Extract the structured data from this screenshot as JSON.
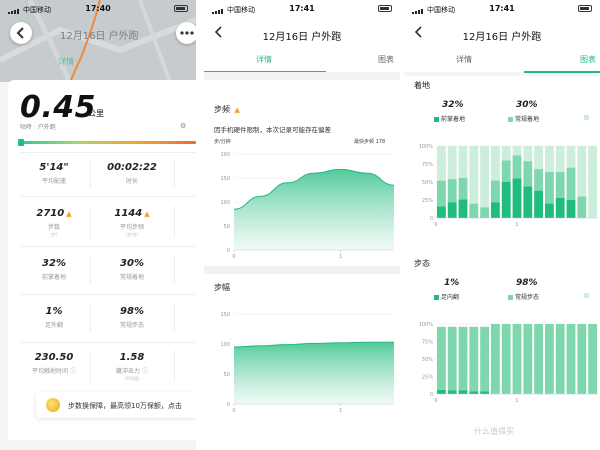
{
  "status": {
    "carrier": "中国移动"
  },
  "panel1": {
    "time": "17:40",
    "title": "12月16日 户外跑",
    "tab_detail": "详情",
    "distance": "0.45",
    "distance_unit": "公里",
    "crumb": "咕咚 · 户外跑",
    "stats": [
      {
        "value": "5'14\"",
        "label": "平均配速",
        "sub": ""
      },
      {
        "value": "00:02:22",
        "label": "时长",
        "sub": ""
      },
      {
        "value": "2710",
        "label": "步数",
        "sub": "(步)",
        "warn": true
      },
      {
        "value": "1144",
        "label": "平均步频",
        "sub": "(步/分)",
        "warn": true
      },
      {
        "value": "32%",
        "label": "前掌着地",
        "sub": ""
      },
      {
        "value": "30%",
        "label": "常规着地",
        "sub": ""
      },
      {
        "value": "1%",
        "label": "足外翻",
        "sub": ""
      },
      {
        "value": "98%",
        "label": "常规步态",
        "sub": ""
      },
      {
        "value": "230.50",
        "label": "平均触地时间",
        "sub": "",
        "info": true
      },
      {
        "value": "1.58",
        "label": "罐冲击力",
        "sub": "(不同值)",
        "info": true
      }
    ],
    "promo": "步数换保障，最高领10万保额，点击"
  },
  "panel2": {
    "time": "17:41",
    "title": "12月16日 户外跑",
    "tab_detail": "详情",
    "tab_chart": "图表",
    "cadence": {
      "title": "步频",
      "note": "因手机硬件限制，本次记录可能存在偏差",
      "unit": "步/分钟",
      "max_label": "最快步频 178",
      "yticks": [
        "200",
        "150",
        "100",
        "50",
        "0"
      ],
      "xticks": [
        "0",
        "1"
      ]
    },
    "stride": {
      "title": "步幅",
      "yticks": [
        "150",
        "100",
        "50",
        "0"
      ],
      "xticks": [
        "0",
        "1"
      ]
    }
  },
  "panel3": {
    "time": "17:41",
    "title": "12月16日 户外跑",
    "tab_detail": "详情",
    "tab_chart": "图表",
    "landing": {
      "title": "着地",
      "pct1": "32%",
      "pct2": "30%",
      "legend1": "前掌着地",
      "legend2": "常规着地",
      "yticks": [
        "100%",
        "75%",
        "50%",
        "25%",
        "0"
      ],
      "xticks": [
        "0",
        "1"
      ]
    },
    "gait": {
      "title": "步态",
      "pct1": "1%",
      "pct2": "98%",
      "legend1": "足内翻",
      "legend2": "常规步态",
      "yticks": [
        "100%",
        "75%",
        "50%",
        "25%",
        "0"
      ],
      "xticks": [
        "0",
        "1"
      ]
    },
    "watermark": "什么值得买"
  },
  "chart_data": [
    {
      "type": "area",
      "title": "步频",
      "x": [
        0,
        0.25,
        0.5,
        0.75,
        1,
        1.25,
        1.5
      ],
      "values": [
        85,
        112,
        140,
        160,
        168,
        160,
        135
      ],
      "ylim": [
        0,
        200
      ]
    },
    {
      "type": "area",
      "title": "步幅",
      "x": [
        0,
        0.25,
        0.5,
        0.75,
        1,
        1.25,
        1.5
      ],
      "values": [
        95,
        97,
        99,
        101,
        102,
        103,
        103
      ],
      "ylim": [
        0,
        150
      ]
    },
    {
      "type": "bar",
      "title": "着地",
      "categories": [
        "1",
        "2",
        "3",
        "4",
        "5",
        "6",
        "7",
        "8",
        "9",
        "10",
        "11",
        "12",
        "13",
        "14",
        "15"
      ],
      "series": [
        {
          "name": "前掌着地",
          "values": [
            16,
            22,
            26,
            0,
            0,
            22,
            50,
            55,
            44,
            38,
            20,
            28,
            25,
            0,
            0
          ]
        },
        {
          "name": "常规着地",
          "values": [
            36,
            32,
            30,
            20,
            15,
            30,
            30,
            32,
            35,
            30,
            44,
            36,
            45,
            30,
            0
          ]
        },
        {
          "name": "",
          "values": [
            48,
            46,
            44,
            80,
            85,
            48,
            20,
            13,
            21,
            32,
            36,
            36,
            30,
            70,
            100
          ]
        }
      ],
      "ylim": [
        0,
        100
      ]
    },
    {
      "type": "bar",
      "title": "步态",
      "categories": [
        "1",
        "2",
        "3",
        "4",
        "5",
        "6",
        "7",
        "8",
        "9",
        "10",
        "11",
        "12",
        "13",
        "14",
        "15"
      ],
      "series": [
        {
          "name": "足内翻",
          "values": [
            6,
            5,
            5,
            4,
            4,
            0,
            0,
            0,
            0,
            0,
            0,
            0,
            0,
            0,
            0
          ]
        },
        {
          "name": "常规步态",
          "values": [
            90,
            91,
            91,
            92,
            92,
            100,
            100,
            100,
            100,
            100,
            100,
            100,
            100,
            100,
            100
          ]
        }
      ],
      "ylim": [
        0,
        100
      ]
    }
  ]
}
